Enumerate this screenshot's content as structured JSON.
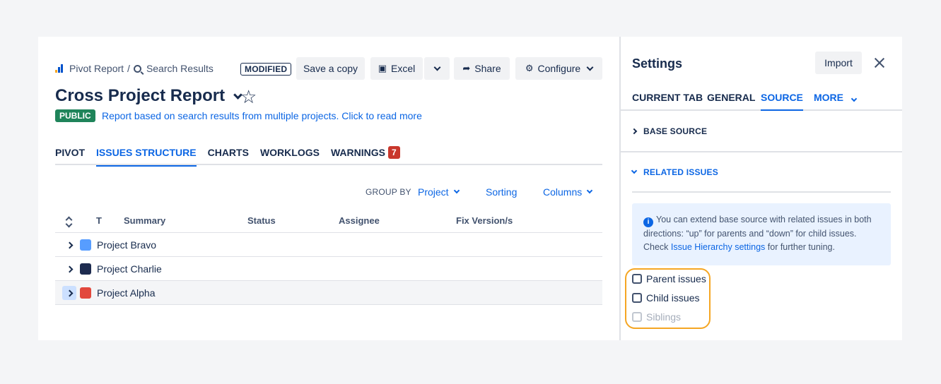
{
  "breadcrumb": {
    "item1": "Pivot Report",
    "separator": "/",
    "item2": "Search Results"
  },
  "status_badge": "MODIFIED",
  "toolbar": {
    "save_copy": "Save a copy",
    "excel": "Excel",
    "share": "Share",
    "configure": "Configure"
  },
  "report": {
    "title": "Cross Project Report",
    "visibility": "PUBLIC",
    "description": "Report based on search results from multiple projects. Click to read more"
  },
  "tabs": [
    {
      "label": "PIVOT"
    },
    {
      "label": "ISSUES STRUCTURE"
    },
    {
      "label": "CHARTS"
    },
    {
      "label": "WORKLOGS"
    },
    {
      "label": "WARNINGS",
      "count": "7"
    }
  ],
  "grouping": {
    "label": "GROUP BY",
    "value": "Project",
    "sorting": "Sorting",
    "columns": "Columns"
  },
  "table": {
    "headers": {
      "type": "T",
      "summary": "Summary",
      "status": "Status",
      "assignee": "Assignee",
      "fix_version": "Fix Version/s"
    },
    "rows": [
      {
        "name": "Project Bravo",
        "color": "#579dff"
      },
      {
        "name": "Project Charlie",
        "color": "#1d2b4f"
      },
      {
        "name": "Project Alpha",
        "color": "#e2483d"
      }
    ]
  },
  "settings": {
    "title": "Settings",
    "import_label": "Import",
    "tabs": {
      "current": "CURRENT TAB",
      "general": "GENERAL",
      "source": "SOURCE",
      "more": "MORE"
    },
    "base_source": "BASE SOURCE",
    "related_issues": "RELATED ISSUES",
    "info": {
      "text1": "You can extend base source with related issues in both directions: “up” for parents and “down” for child issues. Check ",
      "link": "Issue Hierarchy settings",
      "text2": " for further tuning."
    },
    "checkboxes": {
      "parent": "Parent issues",
      "child": "Child issues",
      "siblings": "Siblings"
    }
  },
  "colors": {
    "accent": "#0c66e4",
    "public_badge": "#1f845a",
    "warning_badge": "#c9372c",
    "highlight": "#f5a623"
  }
}
